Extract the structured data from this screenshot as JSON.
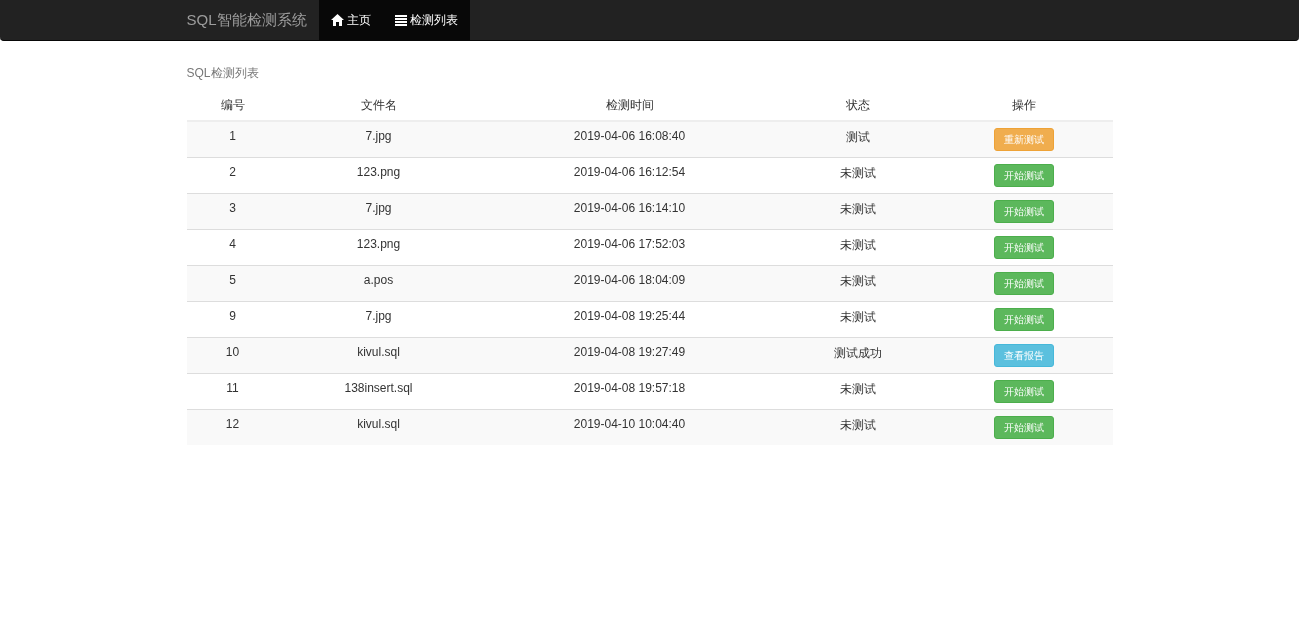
{
  "navbar": {
    "brand": "SQL智能检测系统",
    "items": [
      {
        "label": "主页",
        "kind": "home"
      },
      {
        "label": "检测列表",
        "kind": "list"
      }
    ]
  },
  "page_title": "SQL检测列表",
  "table": {
    "columns": [
      "编号",
      "文件名",
      "检测时间",
      "状态",
      "操作"
    ],
    "rows": [
      {
        "id": "1",
        "file": "7.jpg",
        "time": "2019-04-06 16:08:40",
        "status": "测试",
        "action": {
          "label": "重新测试",
          "kind": "retest"
        }
      },
      {
        "id": "2",
        "file": "123.png",
        "time": "2019-04-06 16:12:54",
        "status": "未测试",
        "action": {
          "label": "开始测试",
          "kind": "start"
        }
      },
      {
        "id": "3",
        "file": "7.jpg",
        "time": "2019-04-06 16:14:10",
        "status": "未测试",
        "action": {
          "label": "开始测试",
          "kind": "start"
        }
      },
      {
        "id": "4",
        "file": "123.png",
        "time": "2019-04-06 17:52:03",
        "status": "未测试",
        "action": {
          "label": "开始测试",
          "kind": "start"
        }
      },
      {
        "id": "5",
        "file": "a.pos",
        "time": "2019-04-06 18:04:09",
        "status": "未测试",
        "action": {
          "label": "开始测试",
          "kind": "start"
        }
      },
      {
        "id": "9",
        "file": "7.jpg",
        "time": "2019-04-08 19:25:44",
        "status": "未测试",
        "action": {
          "label": "开始测试",
          "kind": "start"
        }
      },
      {
        "id": "10",
        "file": "kivul.sql",
        "time": "2019-04-08 19:27:49",
        "status": "测试成功",
        "action": {
          "label": "查看报告",
          "kind": "report"
        }
      },
      {
        "id": "11",
        "file": "138insert.sql",
        "time": "2019-04-08 19:57:18",
        "status": "未测试",
        "action": {
          "label": "开始测试",
          "kind": "start"
        }
      },
      {
        "id": "12",
        "file": "kivul.sql",
        "time": "2019-04-10 10:04:40",
        "status": "未测试",
        "action": {
          "label": "开始测试",
          "kind": "start"
        }
      }
    ]
  }
}
